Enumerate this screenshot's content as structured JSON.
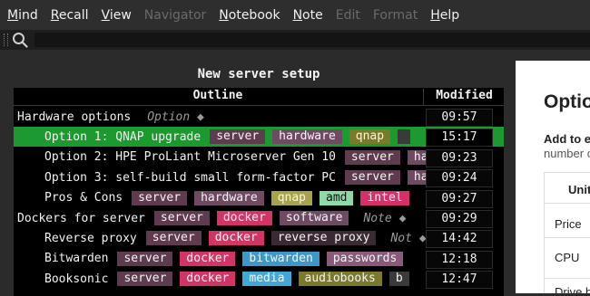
{
  "menu": [
    {
      "pre": "",
      "u": "M",
      "post": "ind",
      "disabled": false
    },
    {
      "pre": "",
      "u": "R",
      "post": "ecall",
      "disabled": false
    },
    {
      "pre": "",
      "u": "V",
      "post": "iew",
      "disabled": false
    },
    {
      "pre": "",
      "u": "",
      "post": "Navigator",
      "disabled": true
    },
    {
      "pre": "",
      "u": "N",
      "post": "otebook",
      "disabled": false
    },
    {
      "pre": "",
      "u": "N",
      "post": "ote",
      "disabled": false
    },
    {
      "pre": "",
      "u": "",
      "post": "Edit",
      "disabled": true
    },
    {
      "pre": "",
      "u": "",
      "post": "Format",
      "disabled": true
    },
    {
      "pre": "",
      "u": "H",
      "post": "elp",
      "disabled": false
    }
  ],
  "search": {
    "icon": "search-icon",
    "value": ""
  },
  "notebook_title": "New server setup",
  "outline": {
    "header_outline": "Outline",
    "header_modified": "Modified",
    "rows": [
      {
        "indent": 0,
        "text": "Hardware options",
        "tags": [],
        "note": "Option",
        "modified": "09:57",
        "selected": false
      },
      {
        "indent": 1,
        "text": "Option 1: QNAP upgrade",
        "tags": [
          [
            "server",
            "#5e3b4e"
          ],
          [
            "hardware",
            "#6f4a63"
          ],
          [
            "qnap",
            "#7a7a2a"
          ],
          [
            "",
            "#3a3a3a"
          ]
        ],
        "note": "",
        "modified": "15:17",
        "selected": true
      },
      {
        "indent": 1,
        "text": "Option 2: HPE ProLiant Microserver Gen 10",
        "tags": [
          [
            "server",
            "#5e3b4e"
          ],
          [
            "ha",
            "#6f4a63"
          ]
        ],
        "note": "",
        "modified": "09:23",
        "selected": false
      },
      {
        "indent": 1,
        "text": "Option 3: self-build small form-factor PC",
        "tags": [
          [
            "server",
            "#5e3b4e"
          ],
          [
            "ha",
            "#6f4a63"
          ]
        ],
        "note": "",
        "modified": "09:24",
        "selected": false
      },
      {
        "indent": 1,
        "text": "Pros & Cons",
        "tags": [
          [
            "server",
            "#5e3b4e"
          ],
          [
            "hardware",
            "#6f4a63"
          ],
          [
            "qnap",
            "#a7a34a"
          ],
          [
            "amd",
            "#8fd8a8"
          ],
          [
            "intel",
            "#d6306a"
          ]
        ],
        "note": "",
        "modified": "09:27",
        "selected": false
      },
      {
        "indent": 0,
        "text": "Dockers for server",
        "tags": [
          [
            "server",
            "#5e3b4e"
          ],
          [
            "docker",
            "#d13465"
          ],
          [
            "software",
            "#6f4a63"
          ]
        ],
        "note": "Note",
        "modified": "09:29",
        "selected": false
      },
      {
        "indent": 1,
        "text": "Reverse proxy",
        "tags": [
          [
            "server",
            "#5e3b4e"
          ],
          [
            "docker",
            "#d13465"
          ],
          [
            "reverse proxy",
            "#3a2a33"
          ]
        ],
        "note": "Not",
        "modified": "14:42",
        "selected": false
      },
      {
        "indent": 1,
        "text": "Bitwarden",
        "tags": [
          [
            "server",
            "#5e3b4e"
          ],
          [
            "docker",
            "#d13465"
          ],
          [
            "bitwarden",
            "#3c98c9"
          ],
          [
            "passwords",
            "#8a5a7a"
          ]
        ],
        "note": "",
        "modified": "12:18",
        "selected": false
      },
      {
        "indent": 1,
        "text": "Booksonic",
        "tags": [
          [
            "server",
            "#5e3b4e"
          ],
          [
            "docker",
            "#d13465"
          ],
          [
            "media",
            "#42a9d6"
          ],
          [
            "audiobooks",
            "#7a7a2a"
          ],
          [
            "b",
            "#3a3a3a"
          ]
        ],
        "note": "",
        "modified": "12:47",
        "selected": false
      }
    ]
  },
  "doc": {
    "heading": "Optio",
    "sub_bold": "Add to e",
    "sub_text": "number c",
    "table_header": "Unit",
    "rows": [
      "Price",
      "CPU",
      "Drive b"
    ]
  }
}
